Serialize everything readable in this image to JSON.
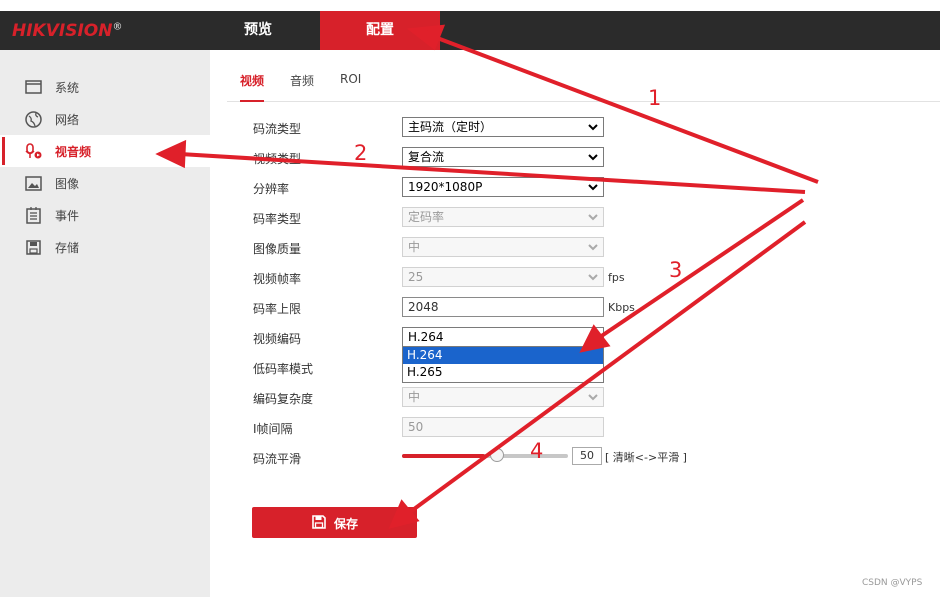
{
  "header": {
    "logo_text": "HIKVISION",
    "logo_mark": "®",
    "nav": [
      {
        "label": "预览",
        "active": false
      },
      {
        "label": "配置",
        "active": true
      }
    ]
  },
  "sidebar": {
    "items": [
      {
        "label": "系统",
        "icon": "monitor-icon"
      },
      {
        "label": "网络",
        "icon": "globe-icon"
      },
      {
        "label": "视音频",
        "icon": "mic-camera-icon",
        "active": true
      },
      {
        "label": "图像",
        "icon": "image-icon"
      },
      {
        "label": "事件",
        "icon": "list-icon"
      },
      {
        "label": "存储",
        "icon": "disk-icon"
      }
    ]
  },
  "subtabs": [
    {
      "label": "视频",
      "active": true
    },
    {
      "label": "音频"
    },
    {
      "label": "ROI"
    }
  ],
  "form": {
    "stream_type": {
      "label": "码流类型",
      "value": "主码流（定时）"
    },
    "video_type": {
      "label": "视频类型",
      "value": "复合流"
    },
    "resolution": {
      "label": "分辨率",
      "value": "1920*1080P"
    },
    "bitrate_type": {
      "label": "码率类型",
      "value": "定码率"
    },
    "image_quality": {
      "label": "图像质量",
      "value": "中"
    },
    "frame_rate": {
      "label": "视频帧率",
      "value": "25",
      "unit": "fps"
    },
    "bitrate_limit": {
      "label": "码率上限",
      "value": "2048",
      "unit": "Kbps"
    },
    "video_codec": {
      "label": "视频编码",
      "value": "H.264",
      "options": [
        "H.264",
        "H.265"
      ]
    },
    "low_bitrate_mode": {
      "label": "低码率模式"
    },
    "codec_complexity": {
      "label": "编码复杂度",
      "value": "中"
    },
    "iframe_interval": {
      "label": "I帧间隔",
      "value": "50"
    },
    "stream_smoothing": {
      "label": "码流平滑",
      "value": "50",
      "level": 0.5,
      "hint": "[ 清晰<->平滑 ]"
    }
  },
  "save": {
    "label": "保存",
    "icon": "save-icon"
  },
  "annotations": {
    "steps": [
      "1",
      "2",
      "3",
      "4"
    ],
    "color": "#e0202a"
  },
  "watermark": "CSDN @VYPS",
  "colors": {
    "accent": "#d7212a",
    "header_bg": "#2b2b2b",
    "sidebar_bg": "#ececec",
    "select_highlight": "#1a64cc"
  }
}
